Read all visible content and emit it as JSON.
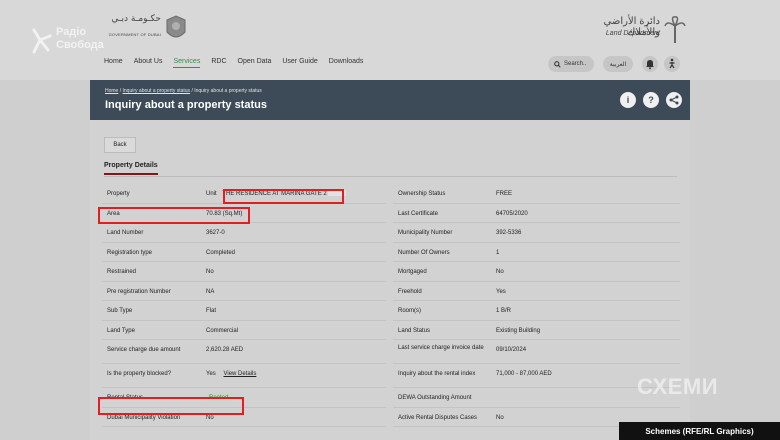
{
  "header": {
    "gov_ar": "حكـومـة دبـي",
    "gov_en": "GOVERNMENT OF DUBAI",
    "ld_ar": "دائرة الأراضي والأملاك",
    "ld_en": "Land Department",
    "radio_line1": "Радіо",
    "radio_line2": "Свобода",
    "nav": [
      "Home",
      "About Us",
      "Services",
      "RDC",
      "Open Data",
      "User Guide",
      "Downloads"
    ],
    "search_label": "Search..",
    "lang_label": "العربية"
  },
  "band": {
    "crumb_home": "Home",
    "crumb_sep": "/",
    "crumb_mid": "Inquiry about a property status",
    "crumb_current": "Inquiry about a property status",
    "title": "Inquiry about a property status",
    "info_glyph": "i",
    "help_glyph": "?",
    "share_glyph": "⋖"
  },
  "content": {
    "back_label": "Back",
    "section_title": "Property Details",
    "left_rows": [
      {
        "k": "Property",
        "v_prefix": "Unit",
        "v": "THE RESIDENCE AT MARINA GATE 2"
      },
      {
        "k": "Area",
        "v": "70.83 (Sq.Mt)"
      },
      {
        "k": "Land Number",
        "v": "3627-0"
      },
      {
        "k": "Registration type",
        "v": "Completed"
      },
      {
        "k": "Restrained",
        "v": "No"
      },
      {
        "k": "Pre registration Number",
        "v": "NA"
      },
      {
        "k": "Sub Type",
        "v": "Flat"
      },
      {
        "k": "Land Type",
        "v": "Commercial"
      },
      {
        "k": "Service charge due amount",
        "v": "2,620.28 AED"
      },
      {
        "k": "Is the property blocked?",
        "v": "Yes",
        "link": "View Details"
      },
      {
        "k": "Rental Status",
        "v": "Rented"
      },
      {
        "k": "Dubai Municipality Violation",
        "v": "No"
      }
    ],
    "right_rows": [
      {
        "k": "Ownership Status",
        "v": "FREE"
      },
      {
        "k": "Last Certificate",
        "v": "64705/2020"
      },
      {
        "k": "Municipality Number",
        "v": "392-5336"
      },
      {
        "k": "Number Of Owners",
        "v": "1"
      },
      {
        "k": "Mortgaged",
        "v": "No"
      },
      {
        "k": "Freehold",
        "v": "Yes"
      },
      {
        "k": "Room(s)",
        "v": "1 B/R"
      },
      {
        "k": "Land Status",
        "v": "Existing Building"
      },
      {
        "k": "Last service charge invoice date",
        "v": "09/10/2024"
      },
      {
        "k": "Inquiry about the rental index",
        "v": "71,000 - 87,000 AED"
      },
      {
        "k": "DEWA Outstanding Amount",
        "v": ""
      },
      {
        "k": "Active Rental Disputes Cases",
        "v": "No"
      }
    ]
  },
  "overlay": {
    "watermark": "СХЕМИ",
    "credit": "Schemes (RFE/RL Graphics)",
    "highlight_color": "#e02020"
  }
}
